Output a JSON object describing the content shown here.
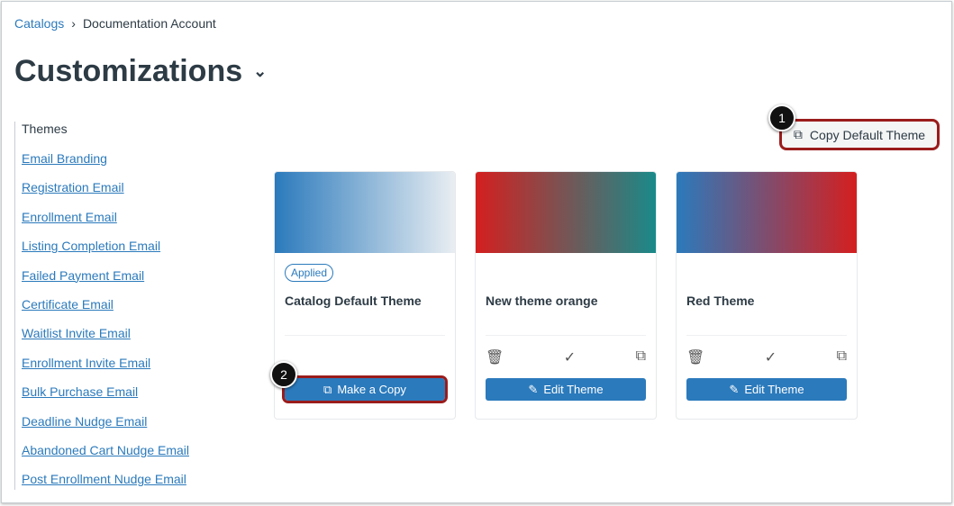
{
  "breadcrumb": {
    "link": "Catalogs",
    "current": "Documentation Account"
  },
  "page_title": "Customizations",
  "sidebar": {
    "current": "Themes",
    "items": [
      "Email Branding",
      "Registration Email",
      "Enrollment Email",
      "Listing Completion Email",
      "Failed Payment Email",
      "Certificate Email",
      "Waitlist Invite Email",
      "Enrollment Invite Email",
      "Bulk Purchase Email",
      "Deadline Nudge Email",
      "Abandoned Cart Nudge Email",
      "Post Enrollment Nudge Email"
    ]
  },
  "copy_default_label": "Copy Default Theme",
  "callouts": [
    "1",
    "2"
  ],
  "cards": [
    {
      "name": "Catalog Default Theme",
      "badge": "Applied",
      "button": "Make a Copy",
      "gradient": [
        "#2b7abc",
        "#e9eef2"
      ]
    },
    {
      "name": "New theme orange",
      "button": "Edit Theme",
      "gradient": [
        "#d41f1f",
        "#1a8a8a"
      ]
    },
    {
      "name": "Red Theme",
      "button": "Edit Theme",
      "gradient": [
        "#2b7abc",
        "#d41f1f"
      ]
    }
  ]
}
